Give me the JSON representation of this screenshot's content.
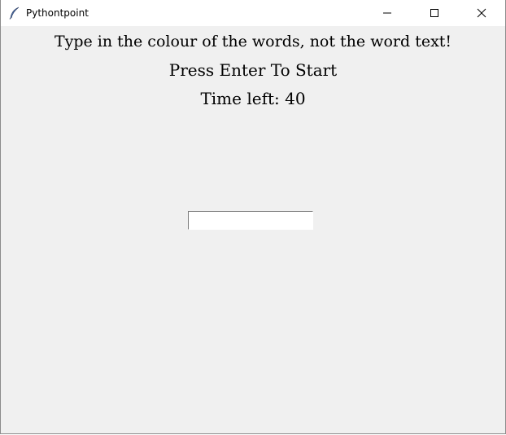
{
  "window": {
    "title": "Pythontpoint",
    "app_icon": "feather-icon",
    "controls": [
      "minimize-icon",
      "maximize-icon",
      "close-icon"
    ]
  },
  "labels": {
    "instructions": "Type in the colour of the words, not the word text!",
    "prompt": "Press Enter To Start",
    "timer": "Time left: 40"
  },
  "entry": {
    "value": ""
  },
  "colors": {
    "background": "#f0f0f0",
    "titlebar": "#ffffff",
    "text": "#000000"
  }
}
